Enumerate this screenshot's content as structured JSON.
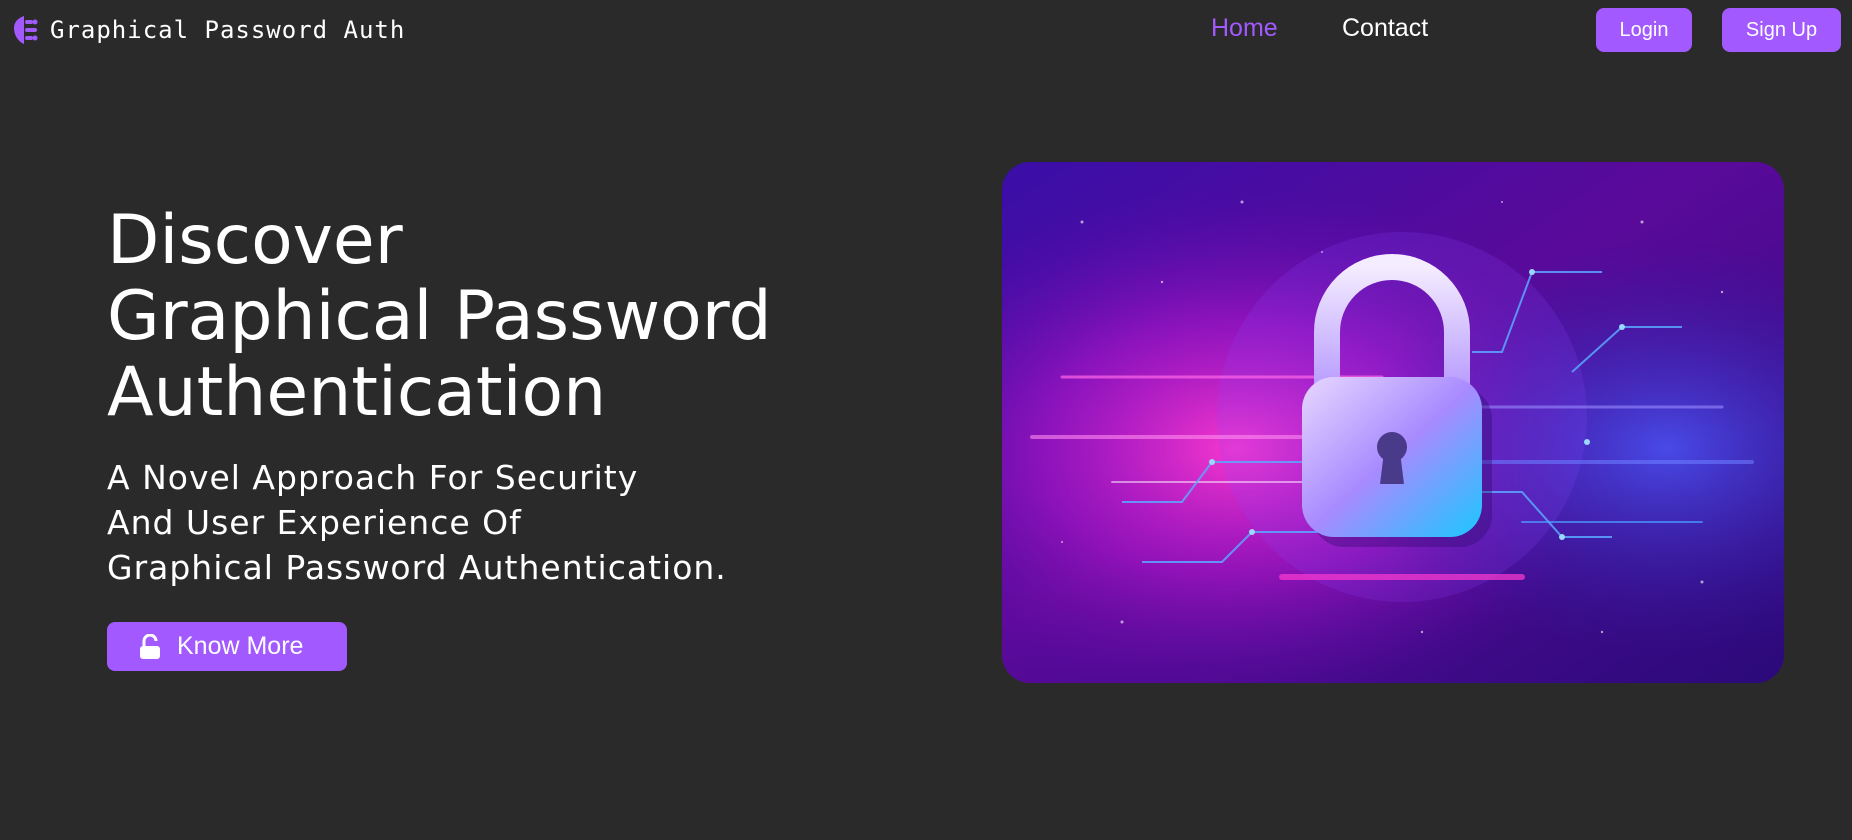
{
  "nav": {
    "brand": "Graphical Password Auth",
    "brand_icon": "shield-key-icon",
    "links": [
      {
        "label": "Home",
        "active": true
      },
      {
        "label": "Contact",
        "active": false
      }
    ],
    "login_label": "Login",
    "signup_label": "Sign Up"
  },
  "hero": {
    "title_lines": [
      "Discover",
      "Graphical Password",
      "Authentication"
    ],
    "subtitle_lines": [
      "A Novel Approach For Security",
      "And User Experience Of",
      "Graphical Password Authentication."
    ],
    "cta_label": "Know More",
    "cta_icon": "unlock-icon",
    "image_icon": "padlock-illustration"
  },
  "colors": {
    "accent": "#a259ff",
    "background": "#2a2a2a",
    "text": "#ffffff"
  }
}
